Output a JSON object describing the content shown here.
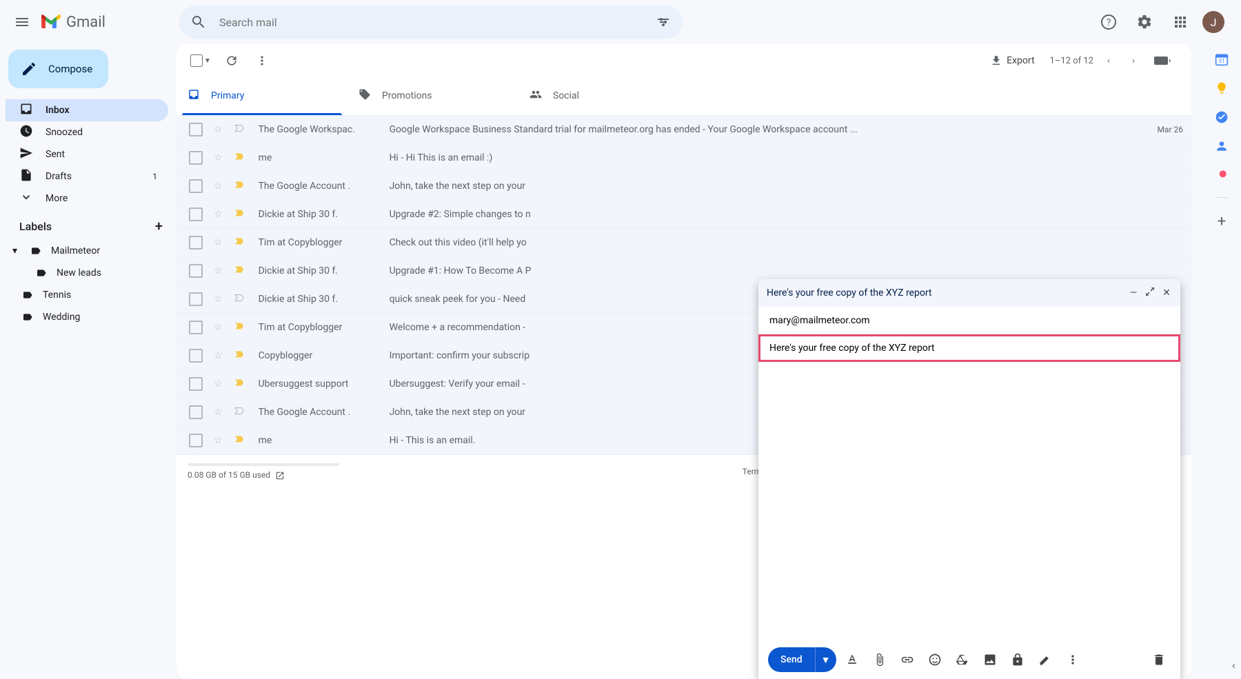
{
  "header": {
    "app_name": "Gmail",
    "search_placeholder": "Search mail",
    "avatar_initial": "J"
  },
  "compose_button": "Compose",
  "nav": [
    {
      "label": "Inbox",
      "active": true,
      "count": ""
    },
    {
      "label": "Snoozed"
    },
    {
      "label": "Sent"
    },
    {
      "label": "Drafts",
      "count": "1"
    },
    {
      "label": "More"
    }
  ],
  "labels_header": "Labels",
  "labels": [
    {
      "label": "Mailmeteor",
      "indent": 0,
      "expandable": true
    },
    {
      "label": "New leads",
      "indent": 1
    },
    {
      "label": "Tennis",
      "indent": 0
    },
    {
      "label": "Wedding",
      "indent": 0
    }
  ],
  "toolbar": {
    "export": "Export",
    "page_info": "1–12 of 12"
  },
  "tabs": [
    {
      "label": "Primary",
      "active": true
    },
    {
      "label": "Promotions"
    },
    {
      "label": "Social"
    }
  ],
  "emails": [
    {
      "sender": "The Google Workspac.",
      "subject": "Google Workspace Business Standard trial for mailmeteor.org has ended",
      "snippet": " - Your Google Workspace account ...",
      "date": "Mar 26",
      "important": false,
      "imp_yellow": false
    },
    {
      "sender": "me",
      "subject": "Hi",
      "snippet": " - Hi This is an email :)",
      "date": "",
      "important": true,
      "imp_yellow": true
    },
    {
      "sender": "The Google Account .",
      "subject": "John, take the next step on your",
      "snippet": "",
      "date": "",
      "important": true,
      "imp_yellow": true
    },
    {
      "sender": "Dickie at Ship 30 f.",
      "subject": "Upgrade #2: Simple changes to n",
      "snippet": "",
      "date": "",
      "important": true,
      "imp_yellow": true
    },
    {
      "sender": "Tim at Copyblogger",
      "subject": "Check out this video (it'll help yo",
      "snippet": "",
      "date": "",
      "important": true,
      "imp_yellow": true
    },
    {
      "sender": "Dickie at Ship 30 f.",
      "subject": "Upgrade #1: How To Become A P",
      "snippet": "",
      "date": "",
      "important": true,
      "imp_yellow": true
    },
    {
      "sender": "Dickie at Ship 30 f.",
      "subject": "quick sneak peek for you",
      "snippet": " - Need",
      "date": "",
      "important": false,
      "imp_yellow": false
    },
    {
      "sender": "Tim at Copyblogger",
      "subject": "Welcome + a recommendation",
      "snippet": " -",
      "date": "",
      "important": true,
      "imp_yellow": true
    },
    {
      "sender": "Copyblogger",
      "subject": "Important: confirm your subscrip",
      "snippet": "",
      "date": "",
      "important": true,
      "imp_yellow": true
    },
    {
      "sender": "Ubersuggest support",
      "subject": "Ubersuggest: Verify your email",
      "snippet": " -",
      "date": "",
      "important": true,
      "imp_yellow": true
    },
    {
      "sender": "The Google Account .",
      "subject": "John, take the next step on your",
      "snippet": "",
      "date": "",
      "important": false,
      "imp_yellow": false
    },
    {
      "sender": "me",
      "subject": "Hi",
      "snippet": " - This is an email.",
      "date": "",
      "important": true,
      "imp_yellow": true
    }
  ],
  "footer": {
    "storage": "0.08 GB of 15 GB used",
    "terms": "Terms · P"
  },
  "compose": {
    "title": "Here's your free copy of the XYZ report",
    "to": "mary@mailmeteor.com",
    "subject": "Here's your free copy of the XYZ report",
    "send": "Send"
  }
}
